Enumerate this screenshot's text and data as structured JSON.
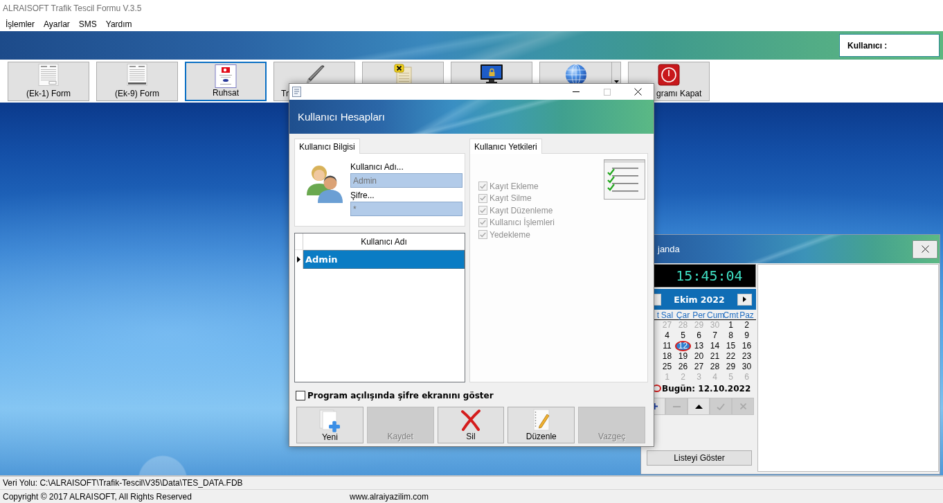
{
  "window": {
    "title": "ALRAISOFT Trafik Tescil Formu V.3.5"
  },
  "menu": [
    "İşlemler",
    "Ayarlar",
    "SMS",
    "Yardım"
  ],
  "banner": {
    "user_label": "Kullanıcı :"
  },
  "toolbar": [
    {
      "kind": "form",
      "label": "(Ek-1) Form",
      "focused": false,
      "dropdown": false
    },
    {
      "kind": "form_scan",
      "label": "(Ek-9) Form",
      "focused": false,
      "dropdown": false
    },
    {
      "kind": "license",
      "label": "Ruhsat",
      "focused": true,
      "dropdown": false
    },
    {
      "kind": "pen",
      "label": "Tr",
      "focused": false,
      "dropdown": false
    },
    {
      "kind": "tagged",
      "focused": false,
      "dropdown": false
    },
    {
      "kind": "lock",
      "focused": false,
      "dropdown": false
    },
    {
      "kind": "globe",
      "focused": false,
      "dropdown": true
    },
    {
      "kind": "power",
      "label": "gramı Kapat",
      "focused": false,
      "dropdown": false
    }
  ],
  "dialog": {
    "controls": [
      {
        "kind": "minimize",
        "disabled": false
      },
      {
        "kind": "maximize",
        "disabled": true
      },
      {
        "kind": "close",
        "disabled": false
      }
    ],
    "header": "Kullanıcı Hesapları",
    "user_info": {
      "tab": "Kullanıcı Bilgisi",
      "username_label": "Kullanıcı Adı...",
      "username": "Admin",
      "password_label": "Şifre...",
      "password": "*"
    },
    "permissions": {
      "tab": "Kullanıcı Yetkileri",
      "items": [
        {
          "label": "Kayıt Ekleme",
          "checked": true,
          "disabled": true
        },
        {
          "label": "Kayıt Silme",
          "checked": true,
          "disabled": true
        },
        {
          "label": "Kayıt Düzenleme",
          "checked": true,
          "disabled": true
        },
        {
          "label": "Kullanıcı İşlemleri",
          "checked": true,
          "disabled": true
        },
        {
          "label": "Yedekleme",
          "checked": true,
          "disabled": true
        }
      ]
    },
    "users_table": {
      "columns": [
        "Kullanıcı Adı"
      ],
      "rows": [
        {
          "cells": [
            "Admin"
          ],
          "selected": true
        }
      ]
    },
    "startup_option": {
      "label": "Program açılışında şifre ekranını göster",
      "checked": false
    },
    "buttons": [
      {
        "kind": "new",
        "label": "Yeni",
        "disabled": false
      },
      {
        "kind": "save",
        "label": "Kaydet",
        "disabled": true
      },
      {
        "kind": "delete",
        "label": "Sil",
        "disabled": false
      },
      {
        "kind": "edit",
        "label": "Düzenle",
        "disabled": false
      },
      {
        "kind": "cancel",
        "label": "Vazgeç",
        "disabled": true
      }
    ]
  },
  "agenda": {
    "title": "janda",
    "clock": "15:45:04",
    "calendar": {
      "month": "Ekim 2022",
      "weekdays": [
        "t",
        "Sal",
        "Çar",
        "Per",
        "Cum",
        "Cmt",
        "Paz"
      ],
      "weeks": [
        [
          {
            "day": "27",
            "muted": true,
            "today": false
          },
          {
            "day": "28",
            "muted": true,
            "today": false
          },
          {
            "day": "29",
            "muted": true,
            "today": false
          },
          {
            "day": "30",
            "muted": true,
            "today": false
          },
          {
            "day": "1",
            "muted": false,
            "today": false
          },
          {
            "day": "2",
            "muted": false,
            "today": false
          }
        ],
        [
          {
            "day": "4",
            "muted": false,
            "today": false
          },
          {
            "day": "5",
            "muted": false,
            "today": false
          },
          {
            "day": "6",
            "muted": false,
            "today": false
          },
          {
            "day": "7",
            "muted": false,
            "today": false
          },
          {
            "day": "8",
            "muted": false,
            "today": false
          },
          {
            "day": "9",
            "muted": false,
            "today": false
          }
        ],
        [
          {
            "day": "11",
            "muted": false,
            "today": false
          },
          {
            "day": "12",
            "muted": false,
            "today": true
          },
          {
            "day": "13",
            "muted": false,
            "today": false
          },
          {
            "day": "14",
            "muted": false,
            "today": false
          },
          {
            "day": "15",
            "muted": false,
            "today": false
          },
          {
            "day": "16",
            "muted": false,
            "today": false
          }
        ],
        [
          {
            "day": "18",
            "muted": false,
            "today": false
          },
          {
            "day": "19",
            "muted": false,
            "today": false
          },
          {
            "day": "20",
            "muted": false,
            "today": false
          },
          {
            "day": "21",
            "muted": false,
            "today": false
          },
          {
            "day": "22",
            "muted": false,
            "today": false
          },
          {
            "day": "23",
            "muted": false,
            "today": false
          }
        ],
        [
          {
            "day": "25",
            "muted": false,
            "today": false
          },
          {
            "day": "26",
            "muted": false,
            "today": false
          },
          {
            "day": "27",
            "muted": false,
            "today": false
          },
          {
            "day": "28",
            "muted": false,
            "today": false
          },
          {
            "day": "29",
            "muted": false,
            "today": false
          },
          {
            "day": "30",
            "muted": false,
            "today": false
          }
        ],
        [
          {
            "day": "1",
            "muted": true,
            "today": false
          },
          {
            "day": "2",
            "muted": true,
            "today": false
          },
          {
            "day": "3",
            "muted": true,
            "today": false
          },
          {
            "day": "4",
            "muted": true,
            "today": false
          },
          {
            "day": "5",
            "muted": true,
            "today": false
          },
          {
            "day": "6",
            "muted": true,
            "today": false
          }
        ]
      ],
      "today_label": "Bugün: 12.10.2022"
    },
    "tools": [
      {
        "kind": "add",
        "disabled": false
      },
      {
        "kind": "remove",
        "disabled": true
      },
      {
        "kind": "up",
        "disabled": false
      },
      {
        "kind": "confirm",
        "disabled": true
      },
      {
        "kind": "cancel",
        "disabled": true
      }
    ],
    "list_button": "Listeyi Göster"
  },
  "status_bar": {
    "data_path": "Veri Yolu: C:\\ALRAISOFT\\Trafik-Tescil\\V35\\Data\\TES_DATA.FDB",
    "copyright": "Copyright © 2017 ALRAISOFT, All Rights Reserved",
    "website": "www.alraiyazilim.com"
  }
}
